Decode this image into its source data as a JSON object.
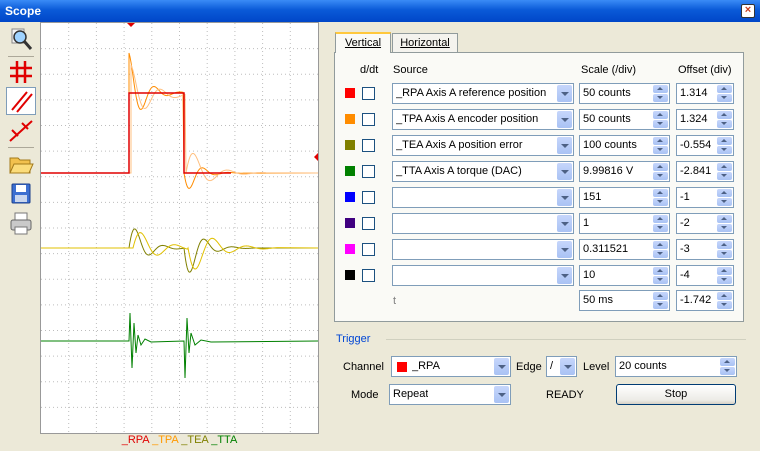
{
  "window": {
    "title": "Scope",
    "close_icon": "close-icon"
  },
  "toolbar": {
    "items": [
      "zoom-icon",
      "grid-icon",
      "cursor-lines-icon",
      "measure-cursor-icon",
      "open-folder-icon",
      "save-icon",
      "print-icon"
    ]
  },
  "plot": {
    "legend": [
      {
        "label": "_RPA",
        "color": "#e00000"
      },
      {
        "label": "_TPA",
        "color": "#ff9900"
      },
      {
        "label": "_TEA",
        "color": "#808000"
      },
      {
        "label": "_TTA",
        "color": "#008000"
      }
    ]
  },
  "tabs": [
    {
      "label": "Vertical"
    },
    {
      "label": "Horizontal"
    }
  ],
  "table": {
    "headers": {
      "ddt": "d/dt",
      "source": "Source",
      "scale": "Scale (/div)",
      "offset": "Offset (div)"
    },
    "rows": [
      {
        "color": "#ff0000",
        "source": "_RPA Axis A reference position",
        "scale": "50 counts",
        "offset": "1.314"
      },
      {
        "color": "#ff8c00",
        "source": "_TPA Axis A encoder position",
        "scale": "50 counts",
        "offset": "1.324"
      },
      {
        "color": "#808000",
        "source": "_TEA Axis A position error",
        "scale": "100 counts",
        "offset": "-0.554"
      },
      {
        "color": "#008000",
        "source": "_TTA Axis A torque (DAC)",
        "scale": "9.99816 V",
        "offset": "-2.841"
      },
      {
        "color": "#0000ff",
        "source": "",
        "scale": "151",
        "offset": "-1"
      },
      {
        "color": "#400080",
        "source": "",
        "scale": "1",
        "offset": "-2"
      },
      {
        "color": "#ff00ff",
        "source": "",
        "scale": "0.311521",
        "offset": "-3"
      },
      {
        "color": "#000000",
        "source": "",
        "scale": "10",
        "offset": "-4"
      }
    ],
    "time": {
      "label": "t",
      "scale": "50 ms",
      "offset": "-1.742"
    }
  },
  "trigger": {
    "title": "Trigger",
    "channel_label": "Channel",
    "channel_value": "_RPA",
    "channel_color": "#ff0000",
    "edge_label": "Edge",
    "edge_value": "/",
    "level_label": "Level",
    "level_value": "20 counts",
    "mode_label": "Mode",
    "mode_value": "Repeat",
    "status": "READY",
    "stop_label": "Stop"
  }
}
